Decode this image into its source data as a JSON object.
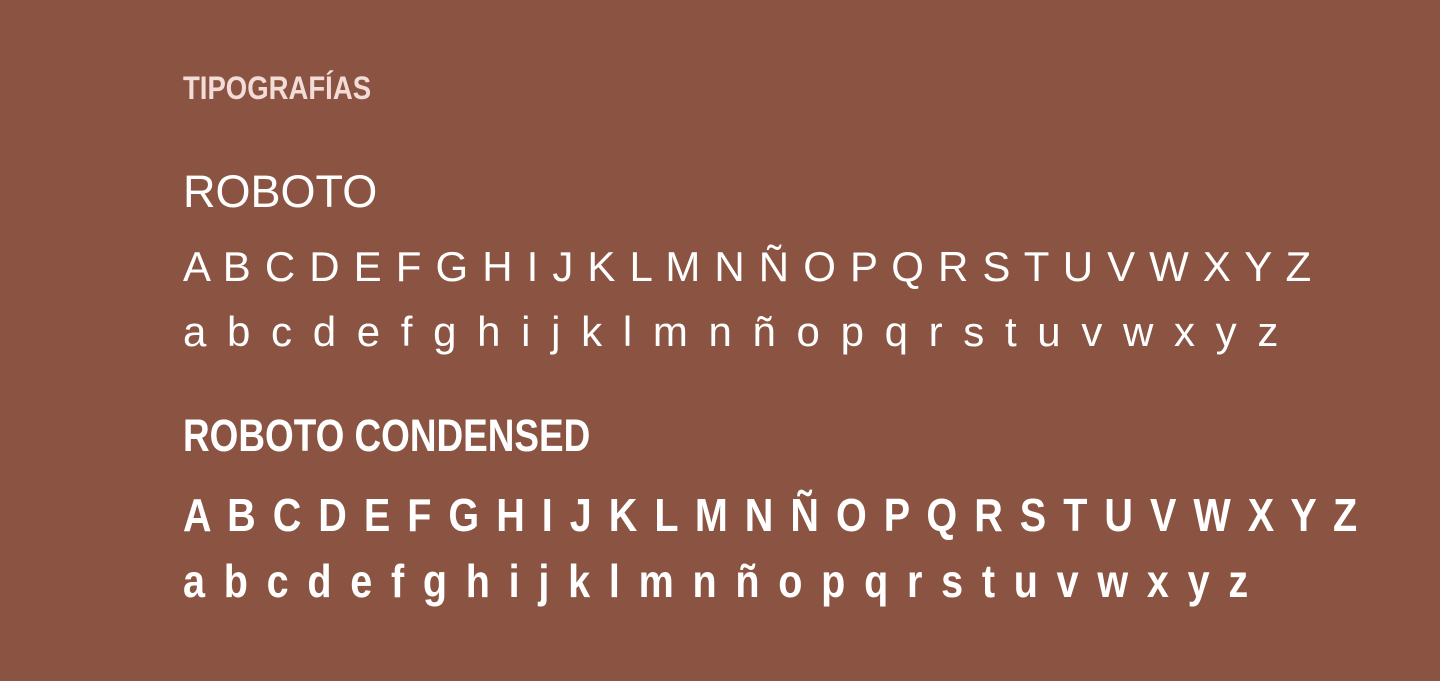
{
  "section": {
    "title": "TIPOGRAFÍAS"
  },
  "fonts": [
    {
      "name": "ROBOTO",
      "uppercase": "A B C D E F G H I J K L M N Ñ O P Q R S T U V W X Y Z",
      "lowercase": "a b c d e f g h i j k l m n ñ o p q r s t u v w x y z"
    },
    {
      "name": "ROBOTO CONDENSED",
      "uppercase": "A B C D E F G H I J K L M N Ñ O P Q R S T U V W X Y Z",
      "lowercase": "a b c d e f g h i j k l m n ñ o p q r s t u v w x y z"
    }
  ],
  "colors": {
    "background": "#8b5442",
    "title": "#f3dcd7",
    "text": "#ffffff"
  }
}
